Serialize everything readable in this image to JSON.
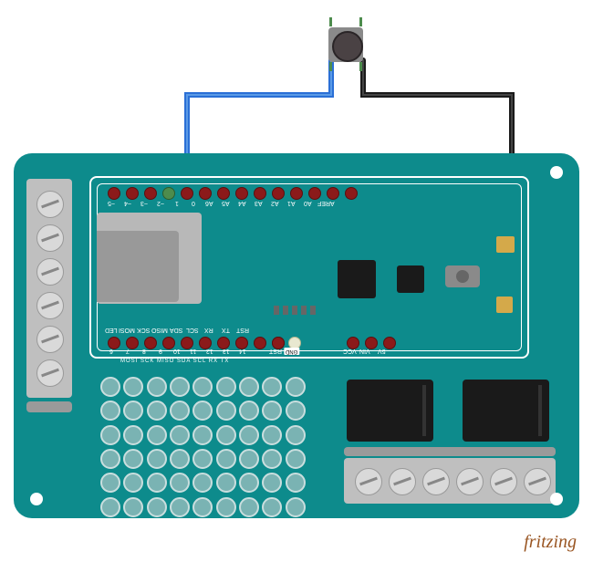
{
  "attribution": "fritzing",
  "pushbutton": {
    "name": "tactile-pushbutton"
  },
  "wires": [
    {
      "name": "wire-signal",
      "color": "#2a6fd6",
      "from": "button-leg-1",
      "to": "pin-digital-2"
    },
    {
      "name": "wire-ground",
      "color": "#1a1a1a",
      "from": "button-leg-4",
      "to": "pin-gnd"
    }
  ],
  "board": {
    "name": "arduino-mkr-relay-protoshield",
    "top_pins": [
      "~5",
      "~4",
      "~3",
      "~2",
      "1",
      "0",
      "A6",
      "A5",
      "A4",
      "A3",
      "A2",
      "A1",
      "A0",
      "AREF"
    ],
    "bottom_pins_left": [
      "LED",
      "6",
      "MOSI",
      "7",
      "SCK",
      "8",
      "MISO",
      "9",
      "SDA",
      "10",
      "SCL",
      "11",
      "RX",
      "12",
      "TX",
      "13",
      "RST",
      "14"
    ],
    "bottom_pins_right": [
      "GND",
      "VCC",
      "VIN",
      "5V"
    ],
    "bottom_labels_lower": [
      "MOSI",
      "SCK",
      "MISO",
      "SDA",
      "SCL",
      "RX",
      "TX"
    ],
    "connected_digital_pin": "~2",
    "connected_power_pin": "GND"
  },
  "terminals": {
    "left_screws": 6,
    "bottom_screws": 6
  },
  "relays": {
    "count": 2
  },
  "proto_area": {
    "rows": 6,
    "cols": 9
  }
}
